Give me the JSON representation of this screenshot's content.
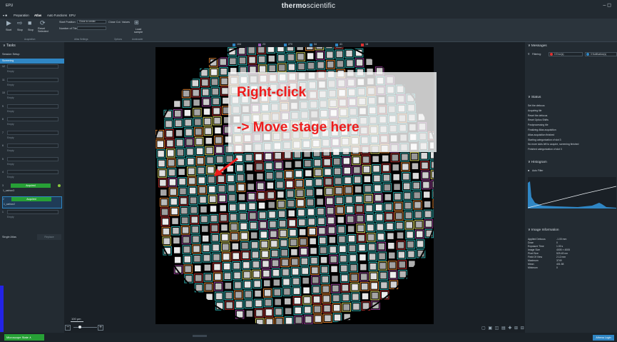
{
  "titlebar": {
    "app_title": "EPU",
    "brand_bold": "thermo",
    "brand_light": "scientific",
    "controls": "–  ◻"
  },
  "menubar": {
    "items": [
      "Preparation",
      "Atlas",
      "Auto Functions",
      "EPU"
    ],
    "active": "Atlas"
  },
  "ribbon": {
    "buttons": [
      "Start",
      "Stop",
      "Stop",
      "Reset Selected"
    ],
    "start_position_label": "Start Position",
    "start_position_value": "Close to center",
    "number_of_tiles_label": "Number of Tiles",
    "close_col_values_label": "Close Col. Values",
    "load_sample_label": "Load sample",
    "groups": [
      "Acquisition",
      "Atlas Settings",
      "Options",
      "Autoloader"
    ]
  },
  "left_panel": {
    "header": "Tasks",
    "session_setup": "Session Setup",
    "screening": "Screening",
    "slots": [
      {
        "num": "12",
        "name": "",
        "status": "Empty"
      },
      {
        "num": "11",
        "name": "",
        "status": "Empty"
      },
      {
        "num": "10",
        "name": "",
        "status": "Empty"
      },
      {
        "num": "9",
        "name": "",
        "status": "Empty"
      },
      {
        "num": "8",
        "name": "",
        "status": "Empty"
      },
      {
        "num": "7",
        "name": "",
        "status": "Empty"
      },
      {
        "num": "6",
        "name": "",
        "status": "Empty"
      },
      {
        "num": "5",
        "name": "",
        "status": "Empty"
      },
      {
        "num": "4",
        "name": "",
        "status": "Empty"
      },
      {
        "num": "3",
        "name": "Acquired",
        "status": "1_carbon3"
      },
      {
        "num": "2",
        "name": "Acquired",
        "status": "1_carbon2"
      },
      {
        "num": "1",
        "name": "",
        "status": "Empty"
      }
    ],
    "single_atlas": "Single Atlas",
    "replace": "Replace"
  },
  "center": {
    "legend": [
      {
        "color": "#2f86c4",
        "num": "104"
      },
      {
        "color": "#9b59b6",
        "num": "23"
      },
      {
        "color": "#2f86c4",
        "num": "270"
      },
      {
        "color": "#2f86c4",
        "num": "34"
      },
      {
        "color": "#2f86c4",
        "num": "41"
      },
      {
        "color": "#e03030",
        "num": "18"
      }
    ],
    "overlay_line1": "Right-click",
    "overlay_line2": "-> Move stage here",
    "scale_label": "100 µm",
    "zoom_minus": "−",
    "zoom_plus": "+",
    "tool_icons": "▢ ▣ ◫ ▤ ✚ ⊞ ⊟"
  },
  "right_panel": {
    "messages_header": "Messages",
    "filtering_label": "Filtering:",
    "errors_label": "0 Error(s)",
    "notifications_label": "0 Notification(s)",
    "status_header": "Status",
    "status_lines": [
      "Set the defocus",
      "Acquiring tile",
      "Reset the defocus",
      "Reset Optics Shifts",
      "Postprocessing tile",
      "Finalizing Atlas acquisition",
      "Atlas acquisition finished",
      "Starting categorization of slot 3",
      "No more slots left to acquire, screening finished",
      "Finished categorization of slot 3"
    ],
    "histogram_header": "Histogram",
    "auto_filter": "Auto Filter",
    "image_info_header": "Image Information",
    "image_info": [
      {
        "k": "Applied Defocus",
        "v": "-1.00 mm"
      },
      {
        "k": "Dose",
        "v": "0"
      },
      {
        "k": "Exposure Time",
        "v": "1.00 s"
      },
      {
        "k": "Image Size",
        "v": "4005 × 4005"
      },
      {
        "k": "Pixel Size",
        "v": "529.49 nm"
      },
      {
        "k": "Field Of View",
        "v": "2.12 mm"
      },
      {
        "k": "Maximum",
        "v": "3749"
      },
      {
        "k": "Mean",
        "v": "401.58"
      },
      {
        "k": "Minimum",
        "v": "0"
      }
    ]
  },
  "statusbar": {
    "microscope_state": "Microscope State",
    "user": "Athena Login"
  }
}
